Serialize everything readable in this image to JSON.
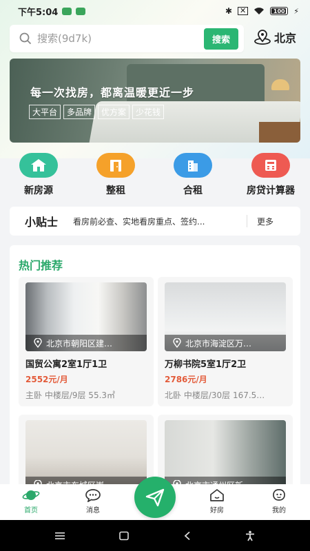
{
  "status": {
    "time": "下午5:04",
    "battery": "100"
  },
  "search": {
    "placeholder": "搜索(9d7k)",
    "button": "搜索"
  },
  "location": {
    "city": "北京"
  },
  "banner": {
    "title": "每一次找房，都离温暖更近一步",
    "tags": [
      "大平台",
      "多品牌",
      "优方案",
      "少花钱"
    ]
  },
  "categories": [
    {
      "label": "新房源",
      "color": "#35c19a"
    },
    {
      "label": "整租",
      "color": "#f5a12a"
    },
    {
      "label": "合租",
      "color": "#3b9be6"
    },
    {
      "label": "房贷计算器",
      "color": "#ee5a52"
    }
  ],
  "tips": {
    "title": "小贴士",
    "text": "看房前必查、实地看房重点、签约...",
    "more": "更多"
  },
  "hot": {
    "title": "热门推荐",
    "cards": [
      {
        "location": "北京市朝阳区建…",
        "title": "国贸公寓2室1厅1卫",
        "price": "2552元/月",
        "meta": "主卧 中楼层/9层 55.3㎡"
      },
      {
        "location": "北京市海淀区万…",
        "title": "万柳书院5室1厅2卫",
        "price": "2786元/月",
        "meta": "北卧 中楼层/30层 167.5…"
      },
      {
        "location": "北京市东城区崇…",
        "title": "",
        "price": "",
        "meta": ""
      },
      {
        "location": "北京市通州区新…",
        "title": "",
        "price": "",
        "meta": ""
      }
    ]
  },
  "nav": [
    {
      "label": "首页",
      "icon": "planet-icon",
      "active": true
    },
    {
      "label": "消息",
      "icon": "chat-icon",
      "active": false
    },
    {
      "label": "",
      "icon": "send-icon",
      "active": false
    },
    {
      "label": "好房",
      "icon": "house-icon",
      "active": false
    },
    {
      "label": "我的",
      "icon": "face-icon",
      "active": false
    }
  ],
  "colors": {
    "accent": "#2bb673",
    "price": "#e35b3a"
  }
}
